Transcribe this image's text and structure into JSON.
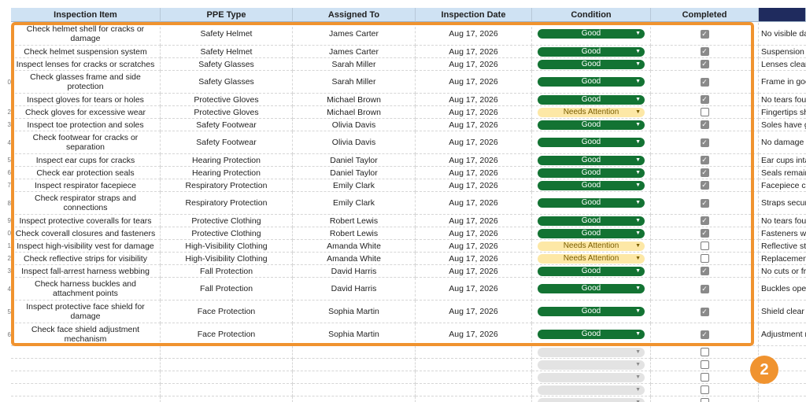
{
  "columns": {
    "item": "Inspection Item",
    "ppe": "PPE Type",
    "assigned": "Assigned To",
    "date": "Inspection Date",
    "condition": "Condition",
    "completed": "Completed",
    "notes": ""
  },
  "rows": [
    {
      "num": "",
      "item": "Check helmet shell for cracks or damage",
      "ppe": "Safety Helmet",
      "assigned": "James Carter",
      "date": "Aug 17, 2026",
      "condition": "Good",
      "completed": true,
      "notes": "No visible da"
    },
    {
      "num": "",
      "item": "Check helmet suspension system",
      "ppe": "Safety Helmet",
      "assigned": "James Carter",
      "date": "Aug 17, 2026",
      "condition": "Good",
      "completed": true,
      "notes": "Suspension"
    },
    {
      "num": "",
      "item": "Inspect lenses for cracks or scratches",
      "ppe": "Safety Glasses",
      "assigned": "Sarah Miller",
      "date": "Aug 17, 2026",
      "condition": "Good",
      "completed": true,
      "notes": "Lenses clear"
    },
    {
      "num": "0",
      "item": "Check glasses frame and side protection",
      "ppe": "Safety Glasses",
      "assigned": "Sarah Miller",
      "date": "Aug 17, 2026",
      "condition": "Good",
      "completed": true,
      "notes": "Frame in goo"
    },
    {
      "num": "",
      "item": "Inspect gloves for tears or holes",
      "ppe": "Protective Gloves",
      "assigned": "Michael Brown",
      "date": "Aug 17, 2026",
      "condition": "Good",
      "completed": true,
      "notes": "No tears fou"
    },
    {
      "num": "2",
      "item": "Check gloves for excessive wear",
      "ppe": "Protective Gloves",
      "assigned": "Michael Brown",
      "date": "Aug 17, 2026",
      "condition": "Needs Attention",
      "completed": false,
      "notes": "Fingertips sh"
    },
    {
      "num": "3",
      "item": "Inspect toe protection and soles",
      "ppe": "Safety Footwear",
      "assigned": "Olivia Davis",
      "date": "Aug 17, 2026",
      "condition": "Good",
      "completed": true,
      "notes": "Soles have g"
    },
    {
      "num": "4",
      "item": "Check footwear for cracks or separation",
      "ppe": "Safety Footwear",
      "assigned": "Olivia Davis",
      "date": "Aug 17, 2026",
      "condition": "Good",
      "completed": true,
      "notes": "No damage d"
    },
    {
      "num": "5",
      "item": "Inspect ear cups for cracks",
      "ppe": "Hearing Protection",
      "assigned": "Daniel Taylor",
      "date": "Aug 17, 2026",
      "condition": "Good",
      "completed": true,
      "notes": "Ear cups inta"
    },
    {
      "num": "6",
      "item": "Check ear protection seals",
      "ppe": "Hearing Protection",
      "assigned": "Daniel Taylor",
      "date": "Aug 17, 2026",
      "condition": "Good",
      "completed": true,
      "notes": "Seals remain"
    },
    {
      "num": "7",
      "item": "Inspect respirator facepiece",
      "ppe": "Respiratory Protection",
      "assigned": "Emily Clark",
      "date": "Aug 17, 2026",
      "condition": "Good",
      "completed": true,
      "notes": "Facepiece cl"
    },
    {
      "num": "8",
      "item": "Check respirator straps and connections",
      "ppe": "Respiratory Protection",
      "assigned": "Emily Clark",
      "date": "Aug 17, 2026",
      "condition": "Good",
      "completed": true,
      "notes": "Straps secur"
    },
    {
      "num": "9",
      "item": "Inspect protective coveralls for tears",
      "ppe": "Protective Clothing",
      "assigned": "Robert Lewis",
      "date": "Aug 17, 2026",
      "condition": "Good",
      "completed": true,
      "notes": "No tears fou"
    },
    {
      "num": "0",
      "item": "Check coverall closures and fasteners",
      "ppe": "Protective Clothing",
      "assigned": "Robert Lewis",
      "date": "Aug 17, 2026",
      "condition": "Good",
      "completed": true,
      "notes": "Fasteners wo"
    },
    {
      "num": "1",
      "item": "Inspect high-visibility vest for damage",
      "ppe": "High-Visibility Clothing",
      "assigned": "Amanda White",
      "date": "Aug 17, 2026",
      "condition": "Needs Attention",
      "completed": false,
      "notes": "Reflective st"
    },
    {
      "num": "2",
      "item": "Check reflective strips for visibility",
      "ppe": "High-Visibility Clothing",
      "assigned": "Amanda White",
      "date": "Aug 17, 2026",
      "condition": "Needs Attention",
      "completed": false,
      "notes": "Replacemen"
    },
    {
      "num": "3",
      "item": "Inspect fall-arrest harness webbing",
      "ppe": "Fall Protection",
      "assigned": "David Harris",
      "date": "Aug 17, 2026",
      "condition": "Good",
      "completed": true,
      "notes": "No cuts or fra"
    },
    {
      "num": "4",
      "item": "Check harness buckles and attachment points",
      "ppe": "Fall Protection",
      "assigned": "David Harris",
      "date": "Aug 17, 2026",
      "condition": "Good",
      "completed": true,
      "notes": "Buckles oper"
    },
    {
      "num": "5",
      "item": "Inspect protective face shield for damage",
      "ppe": "Face Protection",
      "assigned": "Sophia Martin",
      "date": "Aug 17, 2026",
      "condition": "Good",
      "completed": true,
      "notes": "Shield clear"
    },
    {
      "num": "6",
      "item": "Check face shield adjustment mechanism",
      "ppe": "Face Protection",
      "assigned": "Sophia Martin",
      "date": "Aug 17, 2026",
      "condition": "Good",
      "completed": true,
      "notes": "Adjustment r"
    }
  ],
  "empty_rows": 5,
  "highlight_badge": "2",
  "colors": {
    "good": "#137333",
    "needs_attention": "#fde8a6",
    "highlight": "#f0932f",
    "header": "#cfe2f3"
  },
  "icons": {
    "dropdown": "chevron-down-icon",
    "checkbox": "check-icon"
  }
}
